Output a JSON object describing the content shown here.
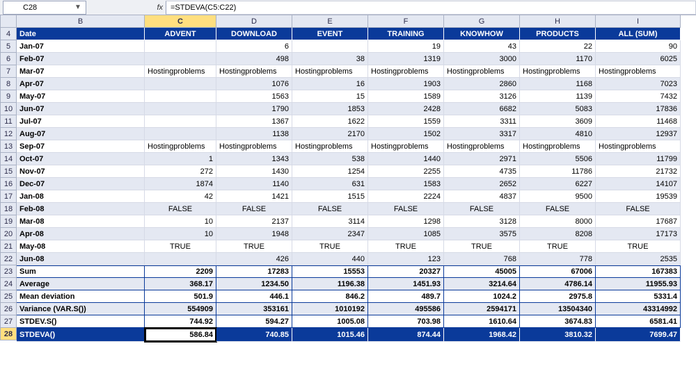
{
  "namebox": {
    "value": "C28",
    "dropdown_glyph": "▼"
  },
  "fx_label": "fx",
  "formula": "=STDEVA(C5:C22)",
  "col_headers": [
    "B",
    "C",
    "D",
    "E",
    "F",
    "G",
    "H",
    "I"
  ],
  "row_headers": [
    "4",
    "5",
    "6",
    "7",
    "8",
    "9",
    "10",
    "11",
    "12",
    "13",
    "14",
    "15",
    "16",
    "17",
    "18",
    "19",
    "20",
    "21",
    "22",
    "23",
    "24",
    "25",
    "26",
    "27",
    "28"
  ],
  "table_header": [
    "Date",
    "ADVENT",
    "DOWNLOAD",
    "EVENT",
    "TRAINING",
    "KNOWHOW",
    "PRODUCTS",
    "ALL (SUM)"
  ],
  "rows": [
    {
      "label": "Jan-07",
      "v": [
        "",
        "6",
        "",
        "19",
        "43",
        "22",
        "90"
      ]
    },
    {
      "label": "Feb-07",
      "v": [
        "",
        "498",
        "38",
        "1319",
        "3000",
        "1170",
        "6025"
      ]
    },
    {
      "label": "Mar-07",
      "v": [
        "Hostingproblems",
        "Hostingproblems",
        "Hostingproblems",
        "Hostingproblems",
        "Hostingproblems",
        "Hostingproblems",
        "Hostingproblems"
      ]
    },
    {
      "label": "Apr-07",
      "v": [
        "",
        "1076",
        "16",
        "1903",
        "2860",
        "1168",
        "7023"
      ]
    },
    {
      "label": "May-07",
      "v": [
        "",
        "1563",
        "15",
        "1589",
        "3126",
        "1139",
        "7432"
      ]
    },
    {
      "label": "Jun-07",
      "v": [
        "",
        "1790",
        "1853",
        "2428",
        "6682",
        "5083",
        "17836"
      ]
    },
    {
      "label": "Jul-07",
      "v": [
        "",
        "1367",
        "1622",
        "1559",
        "3311",
        "3609",
        "11468"
      ]
    },
    {
      "label": "Aug-07",
      "v": [
        "",
        "1138",
        "2170",
        "1502",
        "3317",
        "4810",
        "12937"
      ]
    },
    {
      "label": "Sep-07",
      "v": [
        "Hostingproblems",
        "Hostingproblems",
        "Hostingproblems",
        "Hostingproblems",
        "Hostingproblems",
        "Hostingproblems",
        "Hostingproblems"
      ]
    },
    {
      "label": "Oct-07",
      "v": [
        "1",
        "1343",
        "538",
        "1440",
        "2971",
        "5506",
        "11799"
      ]
    },
    {
      "label": "Nov-07",
      "v": [
        "272",
        "1430",
        "1254",
        "2255",
        "4735",
        "11786",
        "21732"
      ]
    },
    {
      "label": "Dec-07",
      "v": [
        "1874",
        "1140",
        "631",
        "1583",
        "2652",
        "6227",
        "14107"
      ]
    },
    {
      "label": "Jan-08",
      "v": [
        "42",
        "1421",
        "1515",
        "2224",
        "4837",
        "9500",
        "19539"
      ]
    },
    {
      "label": "Feb-08",
      "v": [
        "FALSE",
        "FALSE",
        "FALSE",
        "FALSE",
        "FALSE",
        "FALSE",
        "FALSE"
      ],
      "center": true
    },
    {
      "label": "Mar-08",
      "v": [
        "10",
        "2137",
        "3114",
        "1298",
        "3128",
        "8000",
        "17687"
      ]
    },
    {
      "label": "Apr-08",
      "v": [
        "10",
        "1948",
        "2347",
        "1085",
        "3575",
        "8208",
        "17173"
      ]
    },
    {
      "label": "May-08",
      "v": [
        "TRUE",
        "TRUE",
        "TRUE",
        "TRUE",
        "TRUE",
        "TRUE",
        "TRUE"
      ],
      "center": true
    },
    {
      "label": "Jun-08",
      "v": [
        "",
        "426",
        "440",
        "123",
        "768",
        "778",
        "2535"
      ]
    }
  ],
  "summary": [
    {
      "label": "Sum",
      "v": [
        "2209",
        "17283",
        "15553",
        "20327",
        "45005",
        "67006",
        "167383"
      ]
    },
    {
      "label": "Average",
      "v": [
        "368.17",
        "1234.50",
        "1196.38",
        "1451.93",
        "3214.64",
        "4786.14",
        "11955.93"
      ]
    },
    {
      "label": "Mean deviation",
      "v": [
        "501.9",
        "446.1",
        "846.2",
        "489.7",
        "1024.2",
        "2975.8",
        "5331.4"
      ]
    },
    {
      "label": "Variance (VAR.S())",
      "v": [
        "554909",
        "353161",
        "1010192",
        "495586",
        "2594171",
        "13504340",
        "43314992"
      ]
    },
    {
      "label": "STDEV.S()",
      "v": [
        "744.92",
        "594.27",
        "1005.08",
        "703.98",
        "1610.64",
        "3674.83",
        "6581.41"
      ]
    }
  ],
  "selected_row": {
    "label": "STDEVA()",
    "v": [
      "586.84",
      "740.85",
      "1015.46",
      "874.44",
      "1968.42",
      "3810.32",
      "7699.47"
    ]
  },
  "active_cell": "C28"
}
